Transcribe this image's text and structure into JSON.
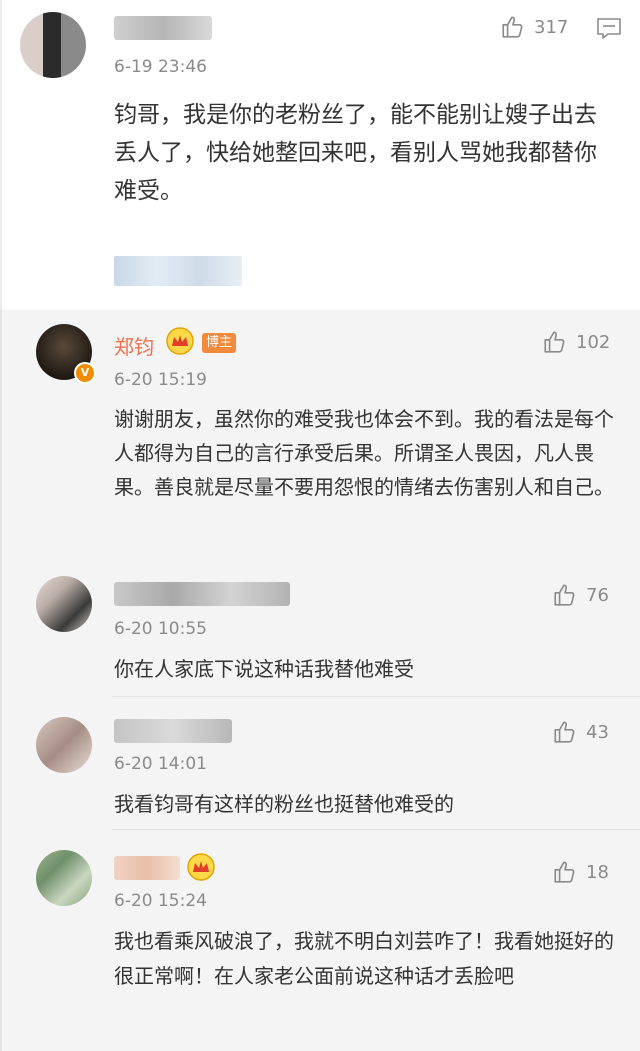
{
  "main_comment": {
    "time": "6-19 23:46",
    "like_count": "317",
    "text": "钧哥，我是你的老粉丝了，能不能别让嫂子出去丢人了，快给她整回来吧，看别人骂她我都替你难受。",
    "like_icon": "thumbs-up-icon",
    "reply_icon": "comment-icon"
  },
  "replies": [
    {
      "author": "郑钧",
      "badge": "博主",
      "verified": "V",
      "time": "6-20 15:19",
      "like_count": "102",
      "text": "谢谢朋友，虽然你的难受我也体会不到。我的看法是每个人都得为自己的言行承受后果。所谓圣人畏因，凡人畏果。善良就是尽量不要用怨恨的情绪去伤害别人和自己。"
    },
    {
      "time": "6-20 10:55",
      "like_count": "76",
      "text": "你在人家底下说这种话我替他难受"
    },
    {
      "time": "6-20 14:01",
      "like_count": "43",
      "text": "我看钧哥有这样的粉丝也挺替他难受的"
    },
    {
      "time": "6-20 15:24",
      "like_count": "18",
      "text": "我也看乘风破浪了，我就不明白刘芸咋了！我看她挺好的很正常啊！在人家老公面前说这种话才丢脸吧"
    }
  ],
  "colors": {
    "author_name": "#eb7350",
    "badge": "#f28a3c",
    "meta_gray": "#8a8a8a",
    "reply_bg": "#f4f4f4"
  }
}
